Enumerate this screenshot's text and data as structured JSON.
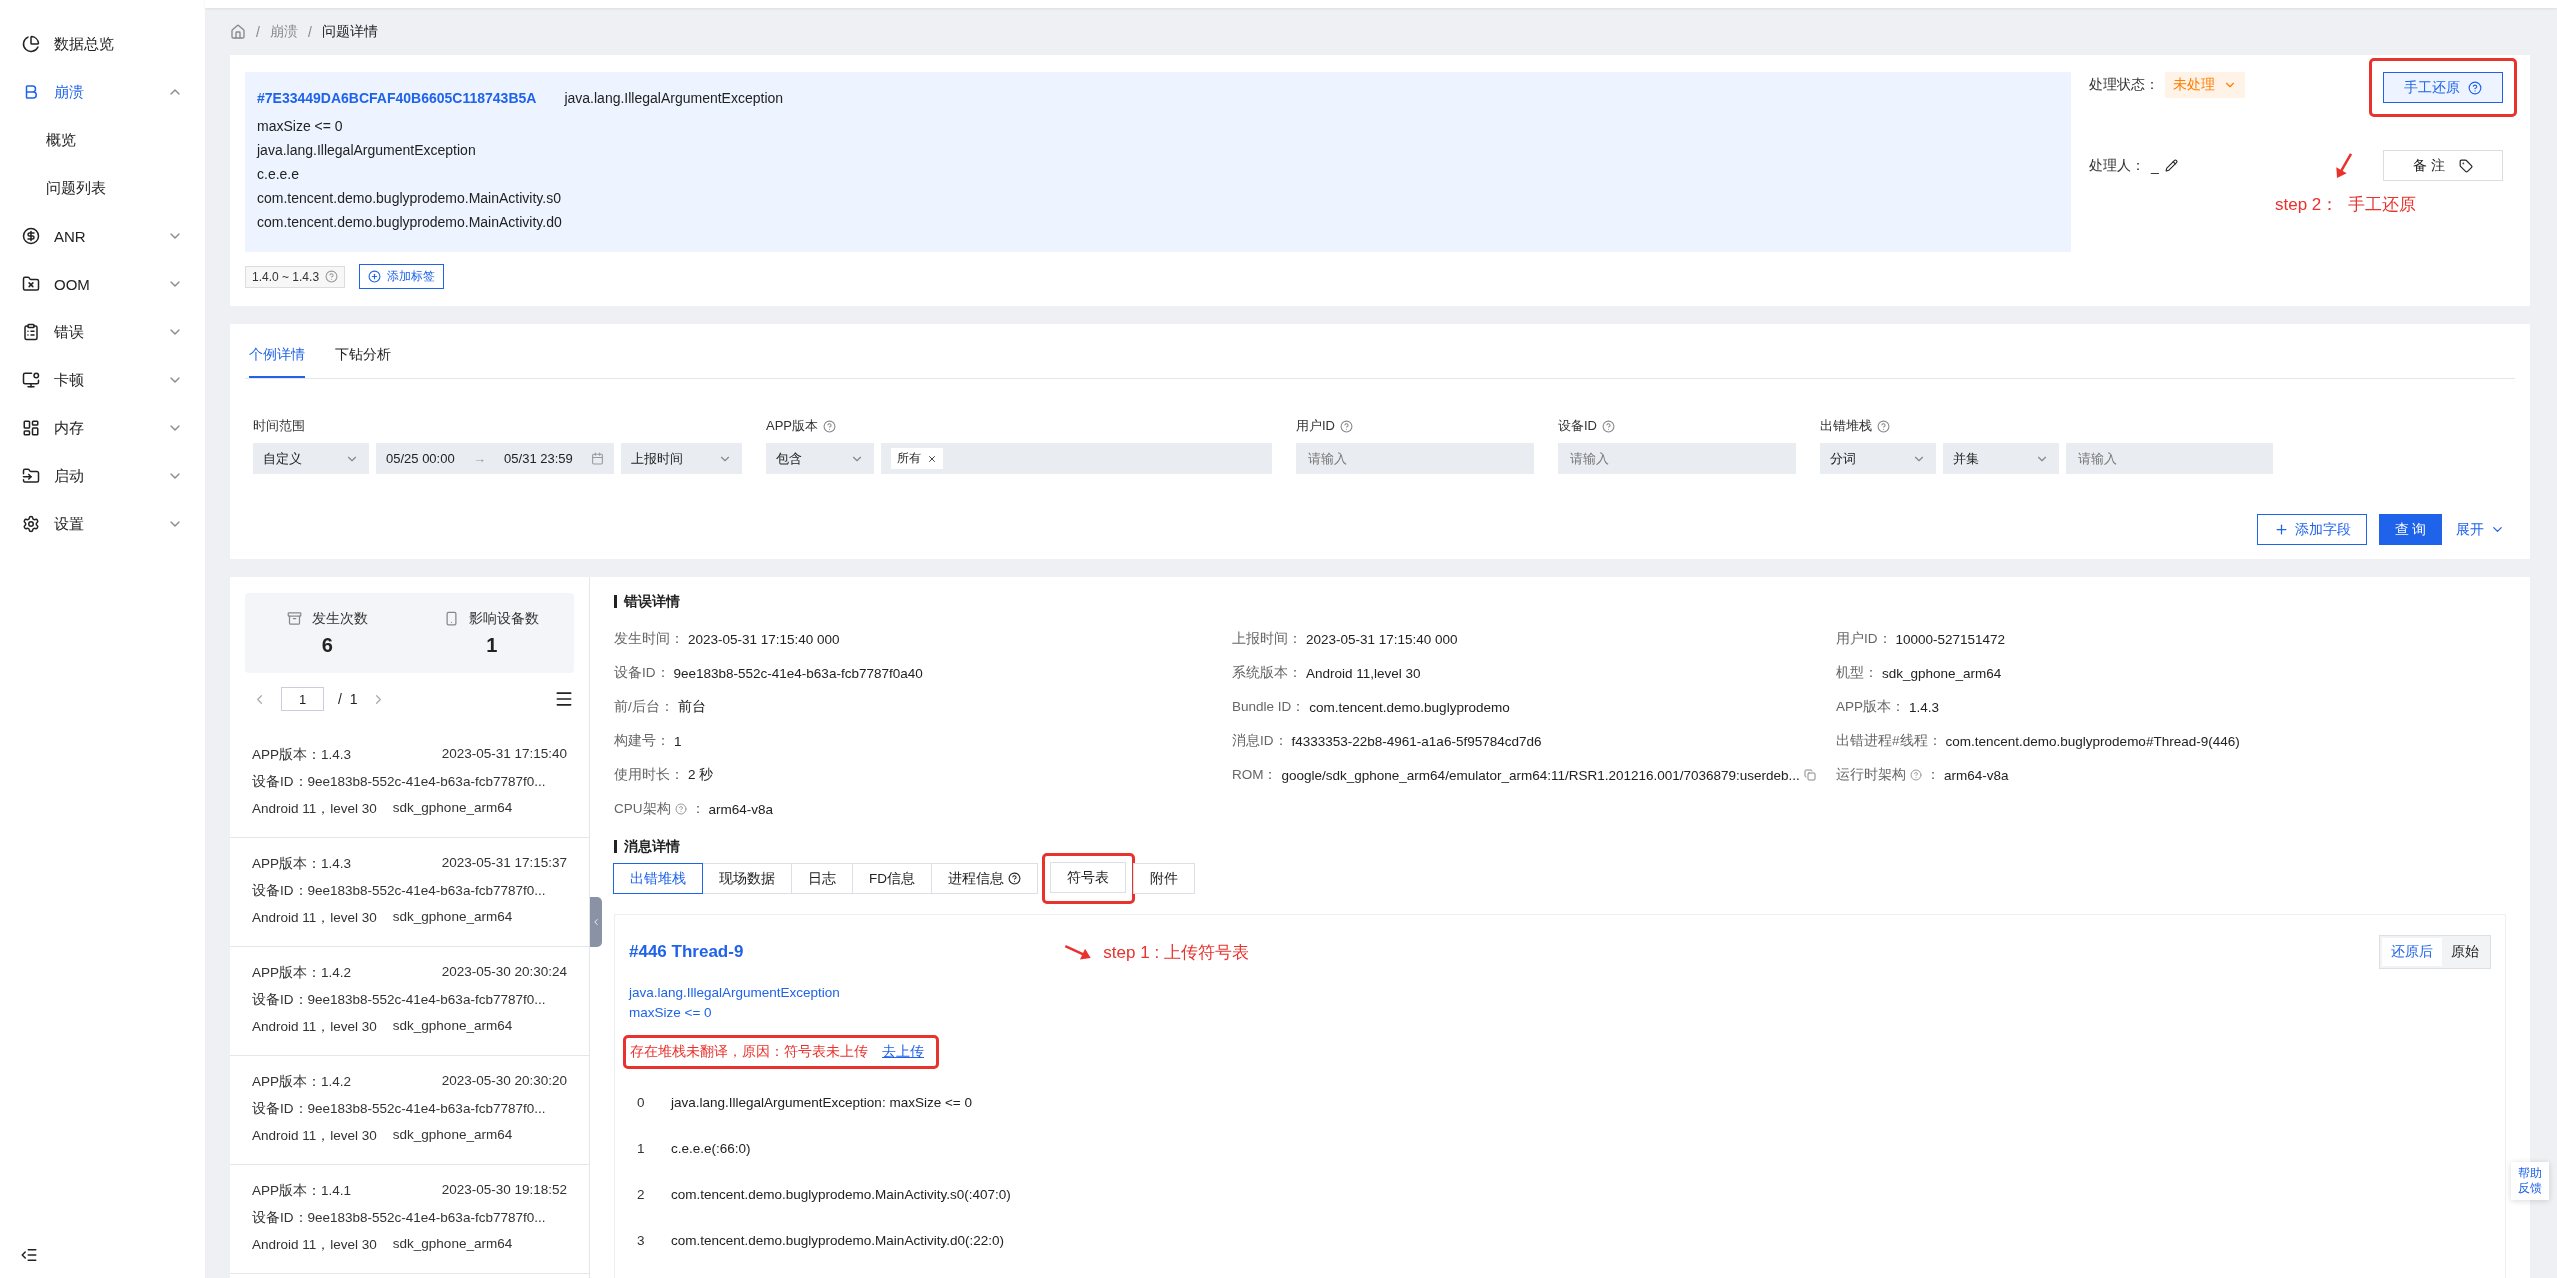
{
  "sidebar": {
    "items": [
      {
        "label": "数据总览",
        "kind": "link",
        "selected": false
      },
      {
        "label": "崩溃",
        "kind": "group",
        "selected": true,
        "expanded": true,
        "children": [
          {
            "label": "概览",
            "selected": false
          },
          {
            "label": "问题列表",
            "selected": false
          }
        ]
      },
      {
        "label": "ANR",
        "kind": "group",
        "selected": false,
        "expanded": false
      },
      {
        "label": "OOM",
        "kind": "group",
        "selected": false,
        "expanded": false
      },
      {
        "label": "错误",
        "kind": "group",
        "selected": false,
        "expanded": false
      },
      {
        "label": "卡顿",
        "kind": "group",
        "selected": false,
        "expanded": false
      },
      {
        "label": "内存",
        "kind": "group",
        "selected": false,
        "expanded": false
      },
      {
        "label": "启动",
        "kind": "group",
        "selected": false,
        "expanded": false
      },
      {
        "label": "设置",
        "kind": "group",
        "selected": false,
        "expanded": false
      }
    ]
  },
  "breadcrumb": {
    "separator": "/",
    "items": [
      "崩溃",
      "问题详情"
    ]
  },
  "issue": {
    "id": "#7E33449DA6BCFAF40B6605C118743B5A",
    "exception": "java.lang.IllegalArgumentException",
    "lines": [
      "maxSize <= 0",
      "java.lang.IllegalArgumentException",
      "c.e.e.e",
      "com.tencent.demo.buglyprodemo.MainActivity.s0",
      "com.tencent.demo.buglyprodemo.MainActivity.d0"
    ],
    "version_tag": "1.4.0 ~ 1.4.3",
    "add_tag": "添加标签"
  },
  "status": {
    "label": "处理状态：",
    "value": "未处理"
  },
  "handler": {
    "label": "处理人：",
    "value": "_"
  },
  "manual_restore": "手工还原",
  "note": "备 注",
  "step2": "step 2：  手工还原",
  "tabs": [
    {
      "label": "个例详情",
      "selected": true
    },
    {
      "label": "下钻分析",
      "selected": false
    }
  ],
  "filters": [
    {
      "label": "时间范围",
      "help": false,
      "controls": [
        {
          "kind": "select",
          "value": "自定义"
        },
        {
          "kind": "daterange",
          "start": "05/25 00:00",
          "separator": "→",
          "end": "05/31 23:59"
        },
        {
          "kind": "select",
          "value": "上报时间"
        }
      ]
    },
    {
      "label": "APP版本",
      "help": true,
      "controls": [
        {
          "kind": "select",
          "value": "包含"
        },
        {
          "kind": "tags",
          "tags": [
            "所有"
          ]
        }
      ]
    },
    {
      "label": "用户ID",
      "help": true,
      "controls": [
        {
          "kind": "input",
          "placeholder": "请输入"
        }
      ]
    },
    {
      "label": "设备ID",
      "help": true,
      "controls": [
        {
          "kind": "input",
          "placeholder": "请输入"
        }
      ]
    },
    {
      "label": "出错堆栈",
      "help": true,
      "controls": [
        {
          "kind": "select",
          "value": "分词"
        },
        {
          "kind": "select",
          "value": "并集"
        },
        {
          "kind": "input",
          "placeholder": "请输入"
        }
      ]
    }
  ],
  "filter_actions": {
    "add_field": "添加字段",
    "query": "查 询",
    "expand": "展开"
  },
  "stats": [
    {
      "label": "发生次数",
      "value": "6"
    },
    {
      "label": "影响设备数",
      "value": "1"
    }
  ],
  "pager": {
    "page": "1",
    "total": "/  1"
  },
  "reports": [
    {
      "version": "APP版本：1.4.3",
      "time": "2023-05-31 17:15:40",
      "device": "设备ID：9ee183b8-552c-41e4-b63a-fcb7787f0...",
      "os": "Android 11，level 30",
      "model": "sdk_gphone_arm64"
    },
    {
      "version": "APP版本：1.4.3",
      "time": "2023-05-31 17:15:37",
      "device": "设备ID：9ee183b8-552c-41e4-b63a-fcb7787f0...",
      "os": "Android 11，level 30",
      "model": "sdk_gphone_arm64"
    },
    {
      "version": "APP版本：1.4.2",
      "time": "2023-05-30 20:30:24",
      "device": "设备ID：9ee183b8-552c-41e4-b63a-fcb7787f0...",
      "os": "Android 11，level 30",
      "model": "sdk_gphone_arm64"
    },
    {
      "version": "APP版本：1.4.2",
      "time": "2023-05-30 20:30:20",
      "device": "设备ID：9ee183b8-552c-41e4-b63a-fcb7787f0...",
      "os": "Android 11，level 30",
      "model": "sdk_gphone_arm64"
    },
    {
      "version": "APP版本：1.4.1",
      "time": "2023-05-30 19:18:52",
      "device": "设备ID：9ee183b8-552c-41e4-b63a-fcb7787f0...",
      "os": "Android 11，level 30",
      "model": "sdk_gphone_arm64"
    }
  ],
  "error_details": {
    "title": "错误详情",
    "fields": [
      {
        "label": "发生时间：",
        "value": "2023-05-31 17:15:40 000",
        "kind": "plain"
      },
      {
        "label": "上报时间：",
        "value": "2023-05-31 17:15:40 000",
        "kind": "plain"
      },
      {
        "label": "用户ID：",
        "value": "10000-527151472",
        "kind": "plain"
      },
      {
        "label": "设备ID：",
        "value": "9ee183b8-552c-41e4-b63a-fcb7787f0a40",
        "kind": "plain"
      },
      {
        "label": "系统版本：",
        "value": "Android 11,level 30",
        "kind": "plain"
      },
      {
        "label": "机型：",
        "value": "sdk_gphone_arm64",
        "kind": "plain"
      },
      {
        "label": "前/后台：",
        "value": "前台",
        "kind": "plain"
      },
      {
        "label": "Bundle ID：",
        "value": "com.tencent.demo.buglyprodemo",
        "kind": "plain"
      },
      {
        "label": "APP版本：",
        "value": "1.4.3",
        "kind": "plain"
      },
      {
        "label": "构建号：",
        "value": "1",
        "kind": "plain"
      },
      {
        "label": "消息ID：",
        "value": "f4333353-22b8-4961-a1a6-5f95784cd7d6",
        "kind": "plain"
      },
      {
        "label": "出错进程#线程：",
        "value": "com.tencent.demo.buglyprodemo#Thread-9(446)",
        "kind": "plain"
      },
      {
        "label": "使用时长：",
        "value": "2 秒",
        "kind": "plain"
      },
      {
        "label": "ROM：",
        "value": "google/sdk_gphone_arm64/emulator_arm64:11/RSR1.201216.001/7036879:userdeb...",
        "kind": "copy"
      },
      {
        "label": "运行时架构",
        "suffix": "：",
        "value": "arm64-v8a",
        "kind": "help"
      },
      {
        "label": "CPU架构",
        "suffix": "：",
        "value": "arm64-v8a",
        "kind": "help"
      }
    ]
  },
  "message_details": {
    "title": "消息详情",
    "tabs": [
      {
        "label": "出错堆栈",
        "selected": true,
        "help": false,
        "highlighted": false
      },
      {
        "label": "现场数据",
        "selected": false,
        "help": false,
        "highlighted": false
      },
      {
        "label": "日志",
        "selected": false,
        "help": false,
        "highlighted": false
      },
      {
        "label": "FD信息",
        "selected": false,
        "help": false,
        "highlighted": false
      },
      {
        "label": "进程信息",
        "selected": false,
        "help": true,
        "highlighted": false
      },
      {
        "label": "符号表",
        "selected": false,
        "help": false,
        "highlighted": true
      },
      {
        "label": "附件",
        "selected": false,
        "help": false,
        "highlighted": false
      }
    ],
    "thread": "#446 Thread-9",
    "step1": "step 1 : 上传符号表",
    "exception": "java.lang.IllegalArgumentException",
    "message": "maxSize <= 0",
    "warning": "存在堆栈未翻译，原因：符号表未上传",
    "warning_link": "去上传",
    "view_toggle": [
      {
        "label": "还原后",
        "selected": true
      },
      {
        "label": "原始",
        "selected": false
      }
    ],
    "frames": [
      {
        "index": "0",
        "text": "java.lang.IllegalArgumentException: maxSize <= 0"
      },
      {
        "index": "1",
        "text": "c.e.e.e(:66:0)"
      },
      {
        "index": "2",
        "text": "com.tencent.demo.buglyprodemo.MainActivity.s0(:407:0)"
      },
      {
        "index": "3",
        "text": "com.tencent.demo.buglyprodemo.MainActivity.d0(:22:0)"
      }
    ]
  },
  "help_float": "帮助反馈"
}
